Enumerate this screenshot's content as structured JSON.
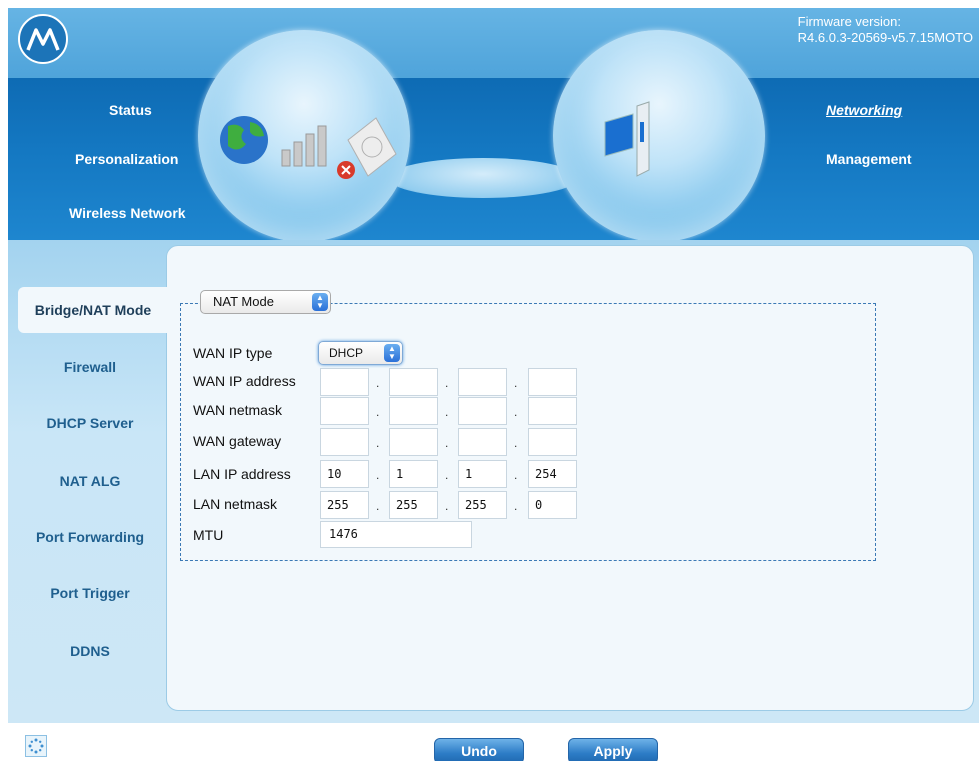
{
  "header": {
    "firmware_label": "Firmware version:",
    "firmware_value": "R4.6.0.3-20569-v5.7.15MOTO",
    "nav_left": [
      "Status",
      "Personalization",
      "Wireless Network"
    ],
    "nav_right": [
      "Networking",
      "Management"
    ],
    "active_nav": "Networking",
    "icons": [
      "motorola-logo-icon",
      "globe-icon",
      "signal-bars-icon",
      "error-x-icon",
      "access-point-icon",
      "computer-icon"
    ]
  },
  "sidebar": {
    "items": [
      "Bridge/NAT Mode",
      "Firewall",
      "DHCP Server",
      "NAT ALG",
      "Port Forwarding",
      "Port Trigger",
      "DDNS"
    ],
    "active": "Bridge/NAT Mode"
  },
  "form": {
    "mode_select": "NAT Mode",
    "wan_ip_type_label": "WAN IP type",
    "wan_ip_type_value": "DHCP",
    "rows": [
      {
        "label": "WAN IP address",
        "octets": [
          "",
          "",
          "",
          ""
        ]
      },
      {
        "label": "WAN netmask",
        "octets": [
          "",
          "",
          "",
          ""
        ]
      },
      {
        "label": "WAN gateway",
        "octets": [
          "",
          "",
          "",
          ""
        ]
      },
      {
        "label": "LAN IP address",
        "octets": [
          "10",
          "1",
          "1",
          "254"
        ]
      },
      {
        "label": "LAN netmask",
        "octets": [
          "255",
          "255",
          "255",
          "0"
        ]
      }
    ],
    "mtu_label": "MTU",
    "mtu_value": "1476",
    "separator": "."
  },
  "footer": {
    "undo_label": "Undo",
    "apply_label": "Apply",
    "icon": "sparkle-icon"
  },
  "colors": {
    "header_blue": "#1478c2",
    "frame_blue": "#c9e6f7",
    "panel_bg": "#f2f8fc",
    "button_blue": "#2d7cc6"
  }
}
